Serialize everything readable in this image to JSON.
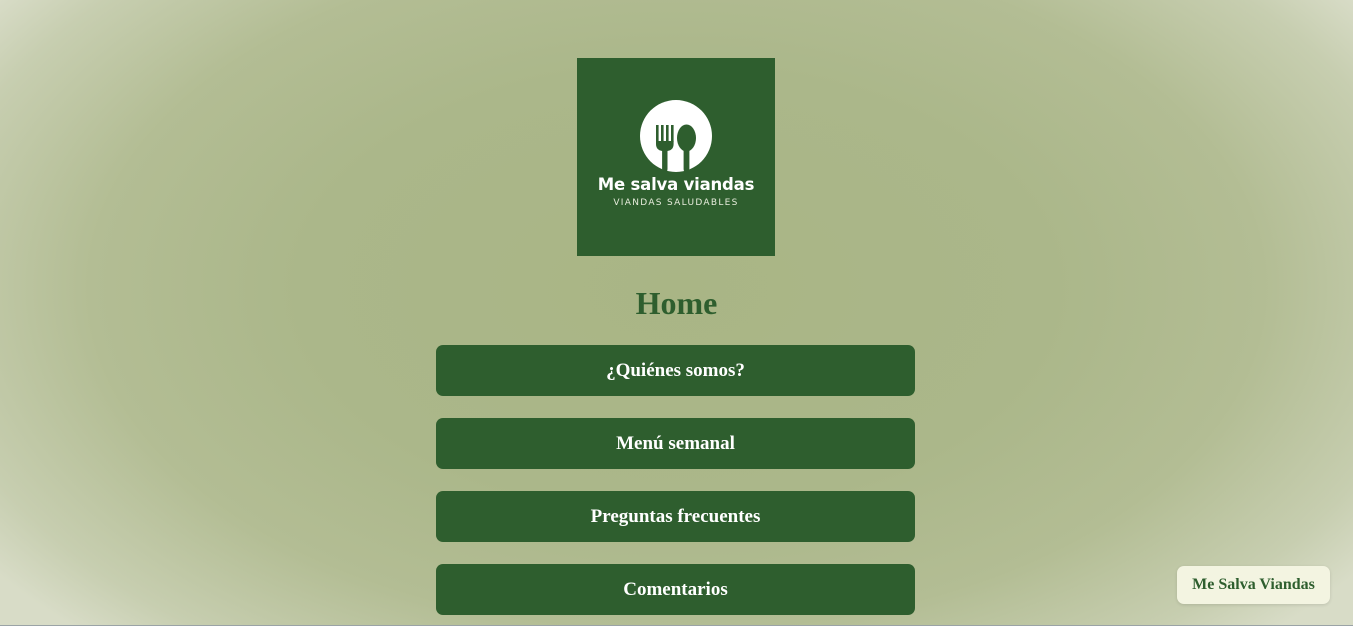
{
  "logo": {
    "brand": "Me salva viandas",
    "tagline": "VIANDAS SALUDABLES",
    "icon": "fork-spoon-icon"
  },
  "page": {
    "title": "Home"
  },
  "nav": {
    "items": [
      {
        "label": "¿Quiénes somos?"
      },
      {
        "label": "Menú semanal"
      },
      {
        "label": "Preguntas frecuentes"
      },
      {
        "label": "Comentarios"
      }
    ]
  },
  "footer_badge": {
    "label": "Me Salva Viandas"
  },
  "colors": {
    "brand_green": "#2e5e2e",
    "background": "#abb78a",
    "badge_bg": "#f3f4e1"
  }
}
